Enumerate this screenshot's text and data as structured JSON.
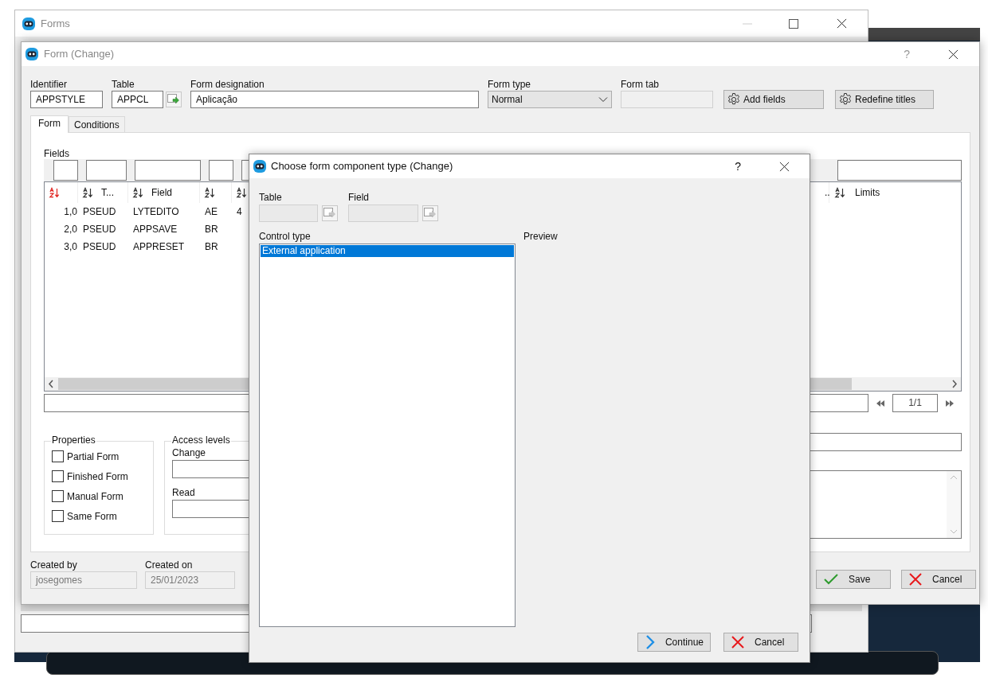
{
  "forms_window": {
    "title": "Forms"
  },
  "form_window": {
    "title": "Form (Change)",
    "help": "?"
  },
  "header_fields": [
    {
      "kind": "text",
      "label": "Identifier",
      "value": "APPSTYLE"
    },
    {
      "kind": "lookup",
      "label": "Table",
      "value": "APPCL"
    },
    {
      "kind": "text",
      "label": "Form designation",
      "value": "Aplicação"
    },
    {
      "kind": "select",
      "label": "Form type",
      "value": "Normal"
    },
    {
      "kind": "disabled",
      "label": "Form tab"
    }
  ],
  "header_buttons": [
    {
      "label": "Add fields"
    },
    {
      "label": "Redefine titles"
    }
  ],
  "tabs": [
    {
      "label": "Form",
      "selected": true
    },
    {
      "label": "Conditions",
      "selected": false
    }
  ],
  "fields": {
    "label": "Fields",
    "columns": [
      {
        "sorted": true
      },
      {
        "label": "T...",
        "sorted": false
      },
      {
        "label": "Field",
        "sorted": false
      },
      {
        "sorted": false
      },
      {
        "sorted": false
      }
    ],
    "right_columns": [
      {
        "label": "..",
        "sort_icon": false
      },
      {
        "label": "Limits",
        "sort_icon": true
      }
    ],
    "rows": [
      [
        "1,0",
        "PSEUD",
        "LYTEDITO",
        "AE",
        "4"
      ],
      [
        "2,0",
        "PSEUD",
        "APPSAVE",
        "BR"
      ],
      [
        "3,0",
        "PSEUD",
        "APPRESET",
        "BR"
      ]
    ],
    "pager": "1/1"
  },
  "properties": {
    "title": "Properties",
    "items": [
      {
        "label": "Partial Form",
        "checked": false
      },
      {
        "label": "Finished Form",
        "checked": false
      },
      {
        "label": "Manual Form",
        "checked": false
      },
      {
        "label": "Same Form",
        "checked": false
      }
    ]
  },
  "access_levels": {
    "title": "Access levels",
    "fields": [
      {
        "label": "Change"
      },
      {
        "label": "Read"
      }
    ]
  },
  "footer_fields": [
    {
      "label": "Created by",
      "value": "josegomes"
    },
    {
      "label": "Created on",
      "value": "25/01/2023"
    }
  ],
  "footer_buttons": [
    {
      "kind": "save",
      "label": "Save"
    },
    {
      "kind": "cancel",
      "label": "Cancel"
    }
  ],
  "dialog": {
    "title": "Choose form component type (Change)",
    "help": "?",
    "table_label": "Table",
    "field_label": "Field",
    "control_type_label": "Control type",
    "options": [
      {
        "label": "External application",
        "selected": true
      }
    ],
    "preview_label": "Preview",
    "buttons": [
      {
        "kind": "continue",
        "label": "Continue"
      },
      {
        "kind": "cancel",
        "label": "Cancel"
      }
    ]
  }
}
